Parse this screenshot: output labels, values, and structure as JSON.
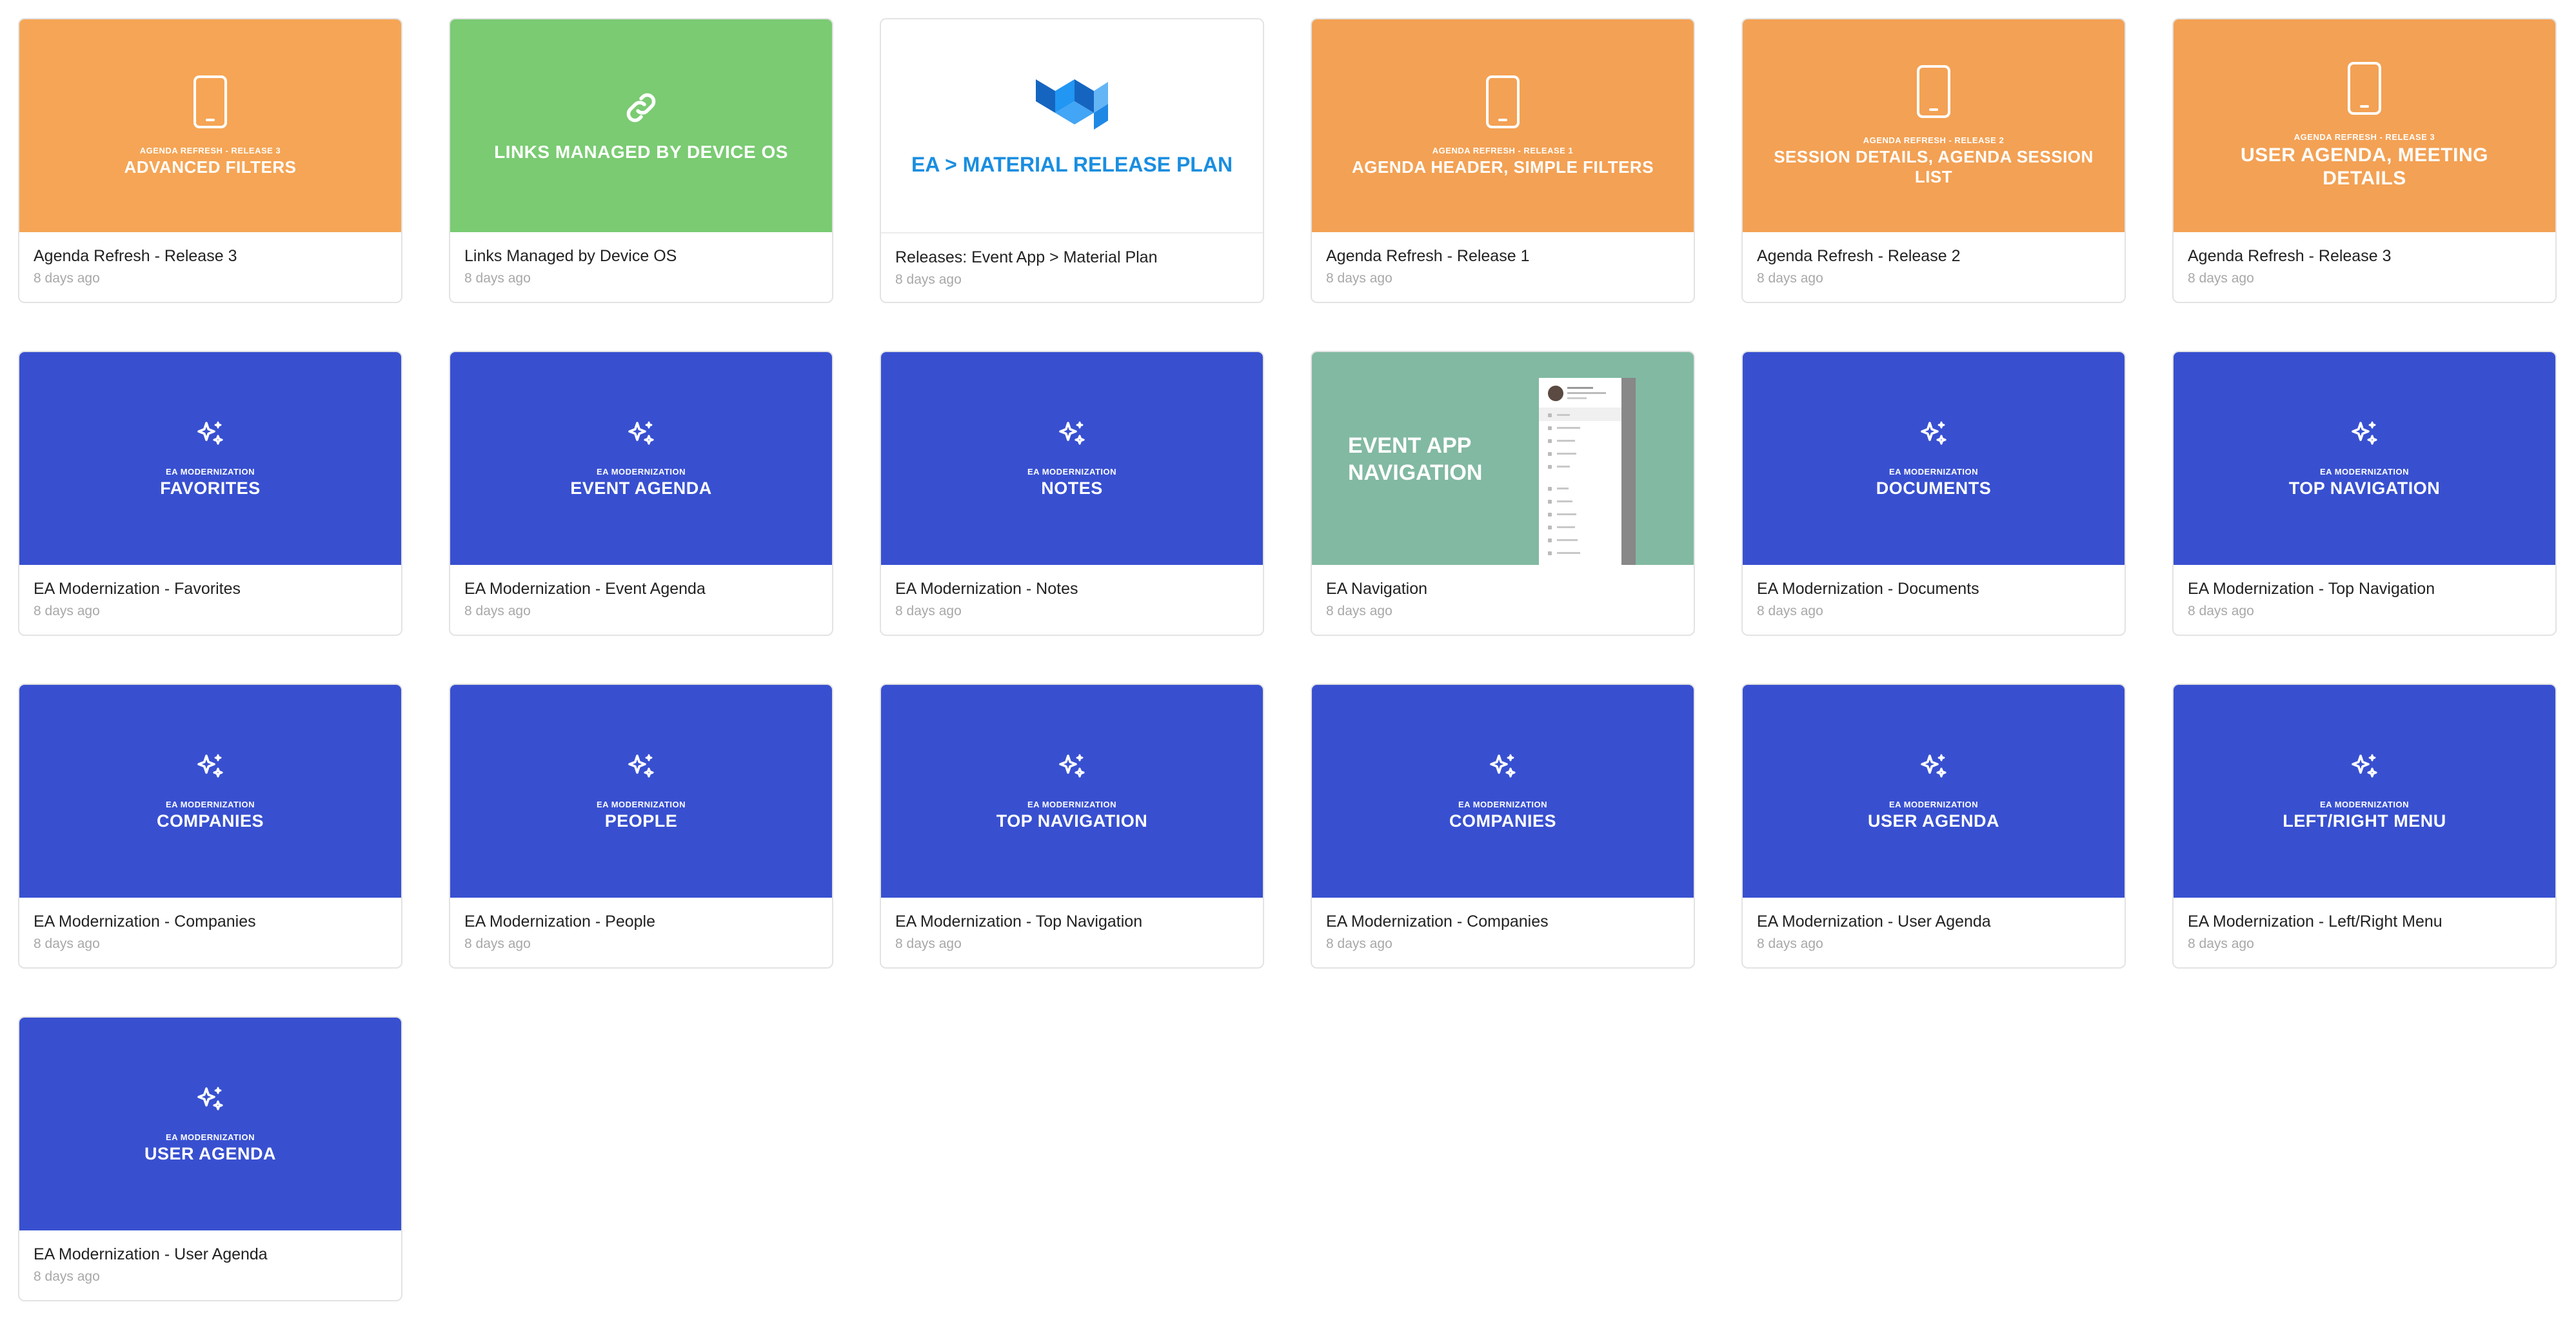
{
  "colors": {
    "orange": "#f5a555",
    "green": "#7acb72",
    "blue": "#3850d0",
    "teal": "#82b9a2",
    "material_blue": "#1a8ee0"
  },
  "cards": [
    {
      "thumb": {
        "eyebrow": "AGENDA REFRESH - RELEASE 3",
        "headline": "ADVANCED FILTERS",
        "icon": "phone-icon"
      },
      "title": "Agenda Refresh - Release 3",
      "time": "8 days ago"
    },
    {
      "thumb": {
        "headline": "LINKS MANAGED BY DEVICE OS",
        "icon": "link-icon"
      },
      "title": "Links Managed by Device OS",
      "time": "8 days ago"
    },
    {
      "thumb": {
        "headline": "EA > MATERIAL RELEASE PLAN",
        "icon": "material-logo-icon"
      },
      "title": "Releases: Event App > Material Plan",
      "time": "8 days ago"
    },
    {
      "thumb": {
        "eyebrow": "AGENDA REFRESH - RELEASE 1",
        "headline": "AGENDA HEADER, SIMPLE FILTERS",
        "icon": "phone-icon"
      },
      "title": "Agenda Refresh - Release 1",
      "time": "8 days ago"
    },
    {
      "thumb": {
        "eyebrow": "AGENDA REFRESH - RELEASE 2",
        "headline": "SESSION DETAILS, AGENDA SESSION LIST",
        "icon": "phone-icon"
      },
      "title": "Agenda Refresh - Release 2",
      "time": "8 days ago"
    },
    {
      "thumb": {
        "eyebrow": "AGENDA REFRESH - RELEASE 3",
        "headline": "USER AGENDA, MEETING DETAILS",
        "icon": "phone-icon"
      },
      "title": "Agenda Refresh - Release 3",
      "time": "8 days ago"
    },
    {
      "thumb": {
        "eyebrow": "EA MODERNIZATION",
        "headline": "FAVORITES",
        "icon": "sparkles-icon"
      },
      "title": "EA Modernization - Favorites",
      "time": "8 days ago"
    },
    {
      "thumb": {
        "eyebrow": "EA MODERNIZATION",
        "headline": "EVENT AGENDA",
        "icon": "sparkles-icon"
      },
      "title": "EA Modernization - Event Agenda",
      "time": "8 days ago"
    },
    {
      "thumb": {
        "eyebrow": "EA MODERNIZATION",
        "headline": "NOTES",
        "icon": "sparkles-icon"
      },
      "title": "EA Modernization - Notes",
      "time": "8 days ago"
    },
    {
      "thumb": {
        "headline": "EVENT APP NAVIGATION",
        "icon": "phone-mockup-icon"
      },
      "title": "EA Navigation",
      "time": "8 days ago"
    },
    {
      "thumb": {
        "eyebrow": "EA MODERNIZATION",
        "headline": "DOCUMENTS",
        "icon": "sparkles-icon"
      },
      "title": "EA Modernization - Documents",
      "time": "8 days ago"
    },
    {
      "thumb": {
        "eyebrow": "EA MODERNIZATION",
        "headline": "TOP NAVIGATION",
        "icon": "sparkles-icon"
      },
      "title": "EA Modernization - Top Navigation",
      "time": "8 days ago"
    },
    {
      "thumb": {
        "eyebrow": "EA MODERNIZATION",
        "headline": "COMPANIES",
        "icon": "sparkles-icon"
      },
      "title": "EA Modernization - Companies",
      "time": "8 days ago"
    },
    {
      "thumb": {
        "eyebrow": "EA MODERNIZATION",
        "headline": "PEOPLE",
        "icon": "sparkles-icon"
      },
      "title": "EA Modernization - People",
      "time": "8 days ago"
    },
    {
      "thumb": {
        "eyebrow": "EA MODERNIZATION",
        "headline": "TOP NAVIGATION",
        "icon": "sparkles-icon"
      },
      "title": "EA Modernization - Top Navigation",
      "time": "8 days ago"
    },
    {
      "thumb": {
        "eyebrow": "EA MODERNIZATION",
        "headline": "COMPANIES",
        "icon": "sparkles-icon"
      },
      "title": "EA Modernization - Companies",
      "time": "8 days ago"
    },
    {
      "thumb": {
        "eyebrow": "EA MODERNIZATION",
        "headline": "USER AGENDA",
        "icon": "sparkles-icon"
      },
      "title": "EA Modernization - User Agenda",
      "time": "8 days ago"
    },
    {
      "thumb": {
        "eyebrow": "EA MODERNIZATION",
        "headline": "LEFT/RIGHT MENU",
        "icon": "sparkles-icon"
      },
      "title": "EA Modernization - Left/Right Menu",
      "time": "8 days ago"
    },
    {
      "thumb": {
        "eyebrow": "EA MODERNIZATION",
        "headline": "USER AGENDA",
        "icon": "sparkles-icon"
      },
      "title": "EA Modernization - User Agenda",
      "time": "8 days ago"
    }
  ]
}
